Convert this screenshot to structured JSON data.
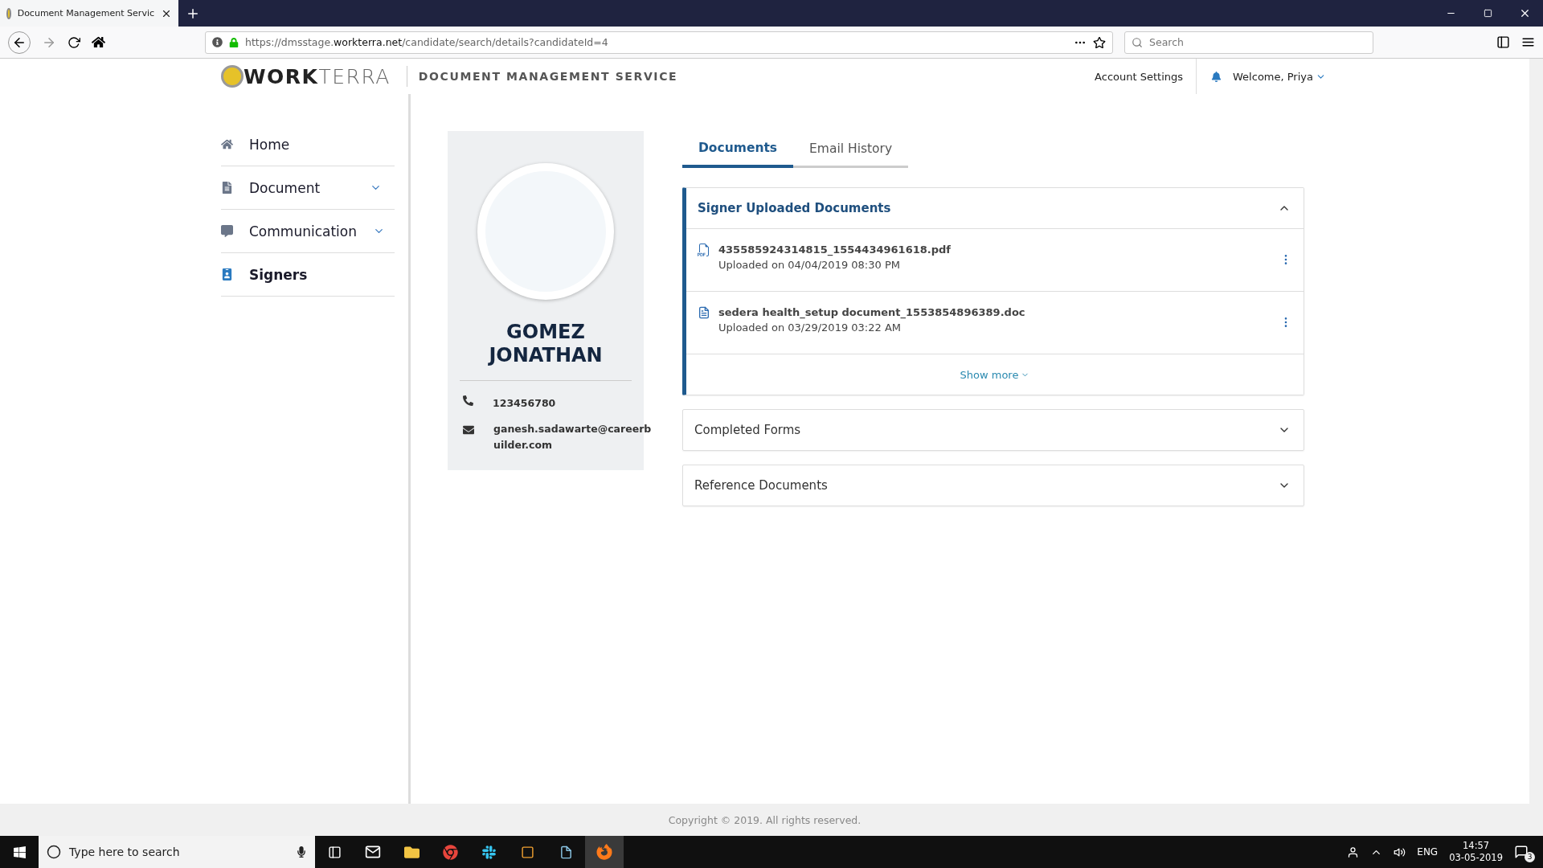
{
  "browser": {
    "tab_title": "Document Management Servic",
    "url_prefix": "https://dmsstage.",
    "url_domain": "workterra.net",
    "url_path": "/candidate/search/details?candidateId=4",
    "search_placeholder": "Search"
  },
  "header": {
    "logo": "**WORK**TERRA",
    "service": "DOCUMENT MANAGEMENT SERVICE",
    "account_settings": "Account Settings",
    "welcome": "Welcome, Priya"
  },
  "sidebar": {
    "items": [
      {
        "kind": "home",
        "label": "Home",
        "selected": false,
        "expandable": false
      },
      {
        "kind": "document",
        "label": "Document",
        "selected": false,
        "expandable": true
      },
      {
        "kind": "chat",
        "label": "Communication",
        "selected": false,
        "expandable": true
      },
      {
        "kind": "badge",
        "label": "Signers",
        "selected": true,
        "expandable": false
      }
    ]
  },
  "profile": {
    "name": "GOMEZ JONATHAN",
    "phone": "123456780",
    "email_lines": [
      "ganesh.sadawarte@careerb",
      "uilder.com"
    ]
  },
  "tabs": [
    {
      "label": "Documents",
      "selected": true
    },
    {
      "label": "Email History",
      "selected": false
    }
  ],
  "sections": [
    {
      "title": "Signer Uploaded Documents",
      "expanded": true,
      "files": [
        {
          "kind": "pdf",
          "name": "435585924314815_1554434961618.pdf",
          "uploaded": "Uploaded on 04/04/2019 08:30 PM"
        },
        {
          "kind": "doc",
          "name": "sedera health_setup document_1553854896389.doc",
          "uploaded": "Uploaded on 03/29/2019 03:22 AM"
        }
      ],
      "show_more": "Show more"
    },
    {
      "title": "Completed Forms",
      "expanded": false
    },
    {
      "title": "Reference Documents",
      "expanded": false
    }
  ],
  "footer": "Copyright © 2019. All rights reserved.",
  "taskbar": {
    "search_placeholder": "Type here to search",
    "language": "ENG",
    "time": "14:57",
    "date": "03-05-2019",
    "notifications": "3"
  }
}
